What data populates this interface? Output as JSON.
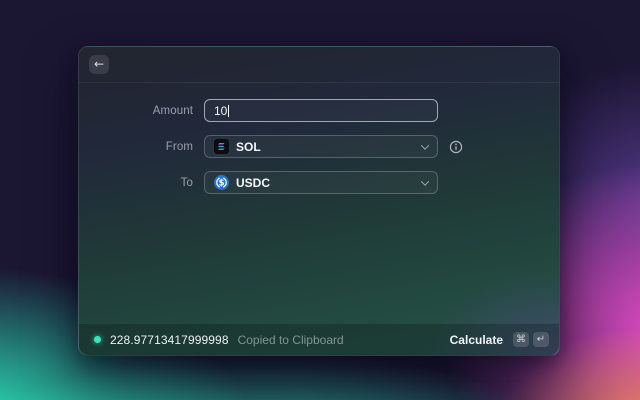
{
  "window": {
    "back_icon": "←"
  },
  "form": {
    "amount": {
      "label": "Amount",
      "value": "10"
    },
    "from": {
      "label": "From",
      "selected": "SOL",
      "token_icon": "sol-logo"
    },
    "to": {
      "label": "To",
      "selected": "USDC",
      "token_icon": "usdc-logo"
    }
  },
  "status_bar": {
    "result_value": "228.97713417999998",
    "toast_text": "Copied to Clipboard",
    "primary_action": "Calculate",
    "shortcut": {
      "cmd": "⌘",
      "enter": "↵"
    }
  },
  "icons": {
    "back": "arrow-left",
    "dropdown": "chevron-down",
    "from_info": "info-circle",
    "status": "status-dot"
  },
  "colors": {
    "background_teal": "#2cf4c6",
    "background_pink": "#ee4fd0",
    "background_navy": "#1b1632",
    "status_dot": "#35e6bf",
    "usdc_blue": "#2775CA",
    "sol_gradient_top": "#14F195",
    "sol_gradient_bottom": "#9945FF"
  }
}
